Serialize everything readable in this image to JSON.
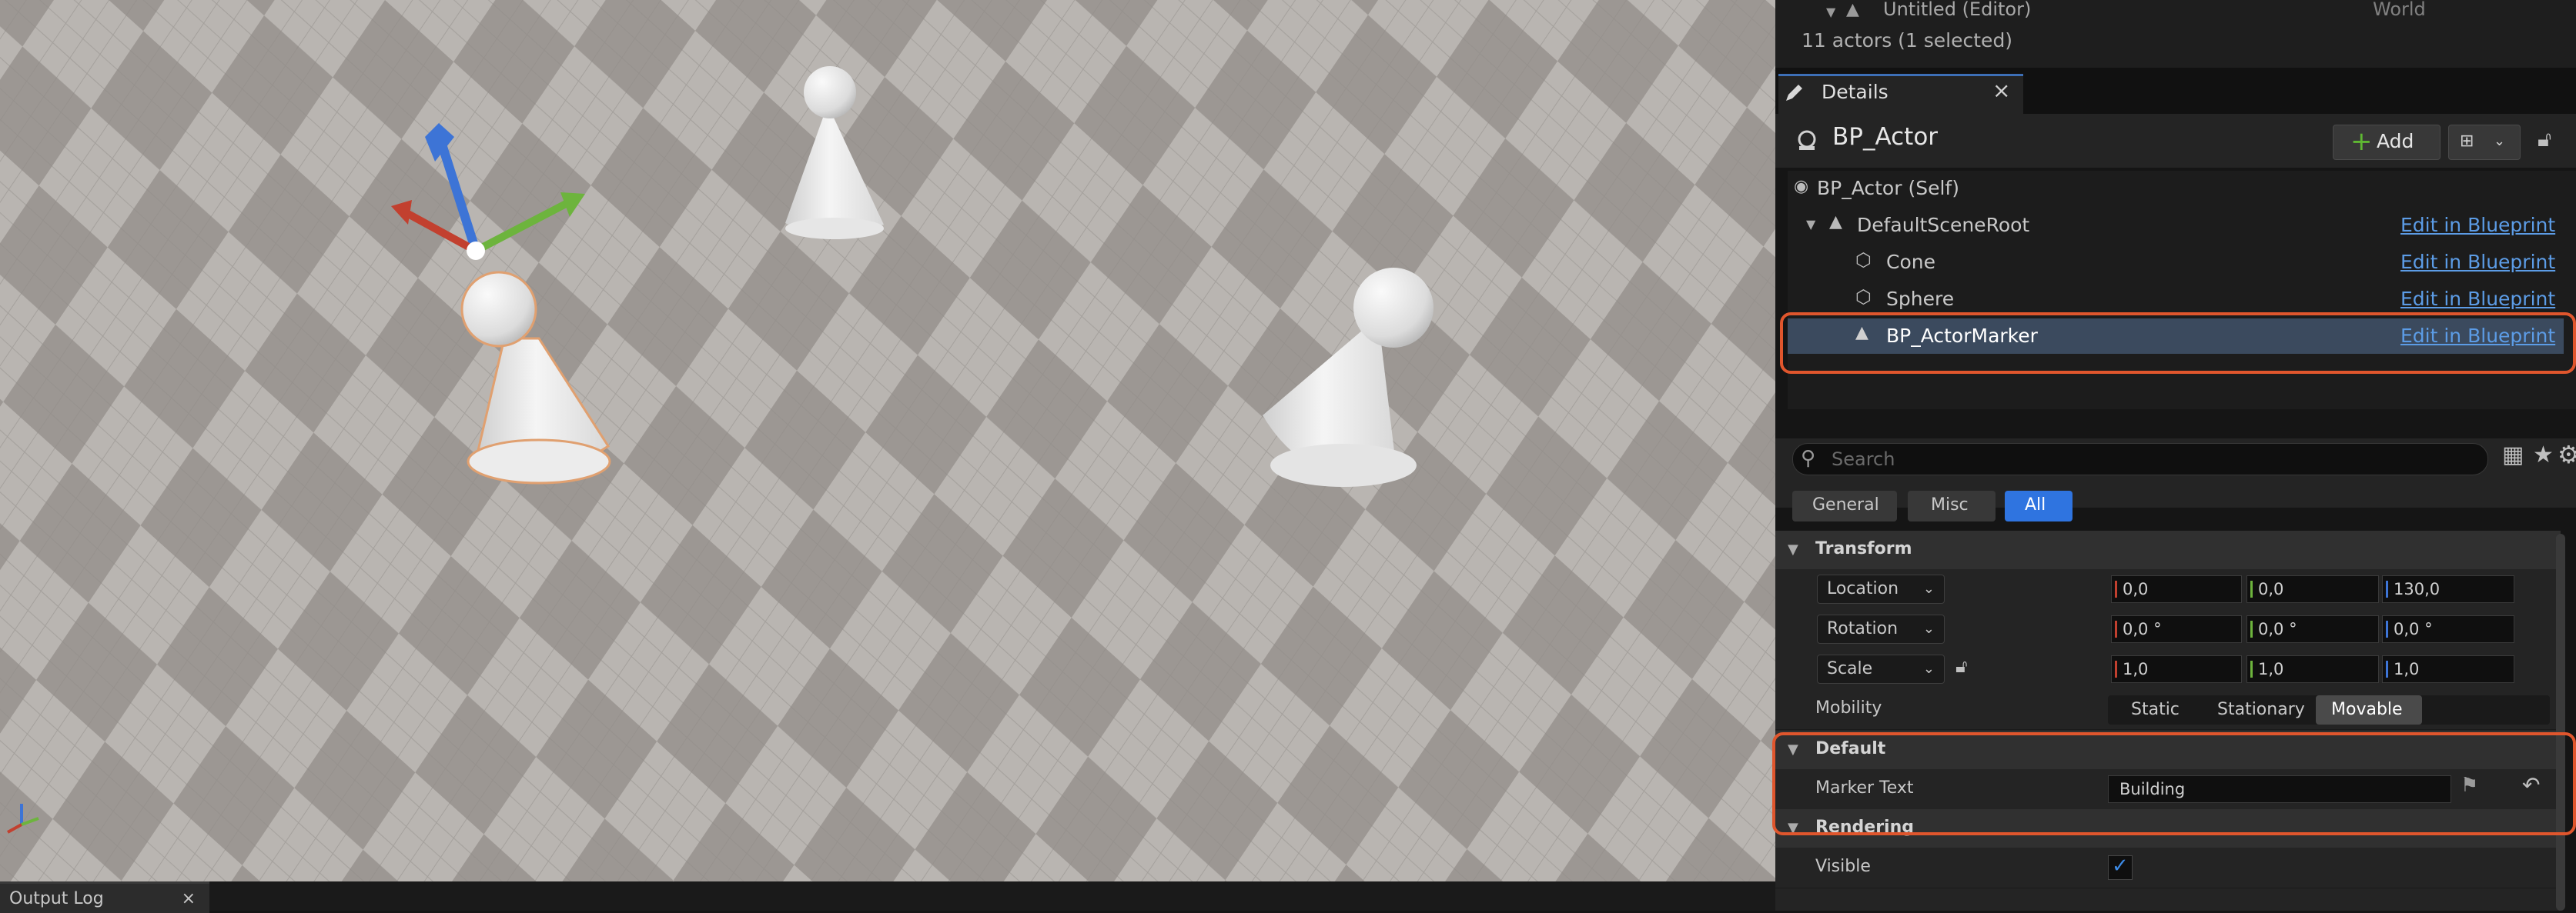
{
  "outliner": {
    "world_row_label": "Untitled (Editor)",
    "world_row_type": "World",
    "status": "11 actors (1 selected)"
  },
  "details": {
    "tab_label": "Details",
    "close_glyph": "×",
    "actor_name": "BP_Actor",
    "add_label": "Add",
    "components": [
      {
        "label": "BP_Actor (Self)",
        "link": ""
      },
      {
        "label": "DefaultSceneRoot",
        "link": "Edit in Blueprint"
      },
      {
        "label": "Cone",
        "link": "Edit in Blueprint"
      },
      {
        "label": "Sphere",
        "link": "Edit in Blueprint"
      },
      {
        "label": "BP_ActorMarker",
        "link": "Edit in Blueprint"
      }
    ],
    "search_placeholder": "Search",
    "filter_tabs": [
      "General",
      "Misc",
      "All"
    ],
    "active_filter": "All"
  },
  "transform": {
    "category": "Transform",
    "location": {
      "label": "Location",
      "x": "0,0",
      "y": "0,0",
      "z": "130,0"
    },
    "rotation": {
      "label": "Rotation",
      "x": "0,0 °",
      "y": "0,0 °",
      "z": "0,0 °"
    },
    "scale": {
      "label": "Scale",
      "x": "1,0",
      "y": "1,0",
      "z": "1,0"
    },
    "mobility_label": "Mobility",
    "mobility_options": [
      "Static",
      "Stationary",
      "Movable"
    ],
    "mobility_selected": "Movable"
  },
  "default_cat": {
    "category": "Default",
    "marker_text_label": "Marker Text",
    "marker_text_value": "Building"
  },
  "rendering": {
    "category": "Rendering",
    "visible_label": "Visible",
    "visible_checked": true
  },
  "output_log": {
    "label": "Output Log",
    "close_glyph": "×"
  },
  "colors": {
    "accent": "#2f74e0",
    "highlight": "#e0562d",
    "link": "#5c9ce6"
  }
}
